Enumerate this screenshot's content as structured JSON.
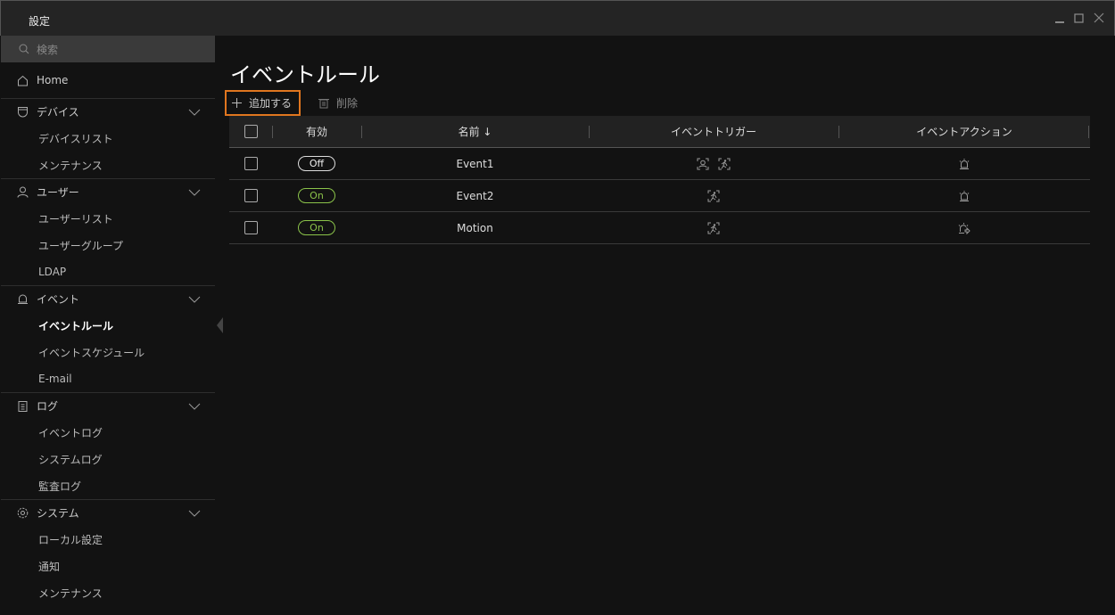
{
  "window": {
    "title": "設定"
  },
  "sidebar": {
    "search_placeholder": "検索",
    "home": "Home",
    "groups": [
      {
        "label": "デバイス",
        "icon": "camera-icon",
        "items": [
          "デバイスリスト",
          "メンテナンス"
        ]
      },
      {
        "label": "ユーザー",
        "icon": "user-icon",
        "items": [
          "ユーザーリスト",
          "ユーザーグループ",
          "LDAP"
        ]
      },
      {
        "label": "イベント",
        "icon": "alarm-icon",
        "items": [
          "イベントルール",
          "イベントスケジュール",
          "E-mail"
        ]
      },
      {
        "label": "ログ",
        "icon": "clipboard-icon",
        "items": [
          "イベントログ",
          "システムログ",
          "監査ログ"
        ]
      },
      {
        "label": "システム",
        "icon": "gear-icon",
        "items": [
          "ローカル設定",
          "通知",
          "メンテナンス"
        ]
      }
    ],
    "active": "イベントルール"
  },
  "main": {
    "title": "イベントルール",
    "toolbar": {
      "add": "追加する",
      "delete": "削除"
    },
    "accent": "#e0761f",
    "columns": [
      "有効",
      "名前 ↓",
      "イベントトリガー",
      "イベントアクション"
    ],
    "rows": [
      {
        "enabled": "Off",
        "name": "Event1",
        "triggers": [
          "face-detection-icon",
          "motion-detection-icon"
        ],
        "action": "alarm-icon"
      },
      {
        "enabled": "On",
        "name": "Event2",
        "triggers": [
          "motion-detection-icon"
        ],
        "action": "alarm-icon"
      },
      {
        "enabled": "On",
        "name": "Motion",
        "triggers": [
          "motion-detection-icon"
        ],
        "action": "alarm-output-icon"
      }
    ]
  }
}
